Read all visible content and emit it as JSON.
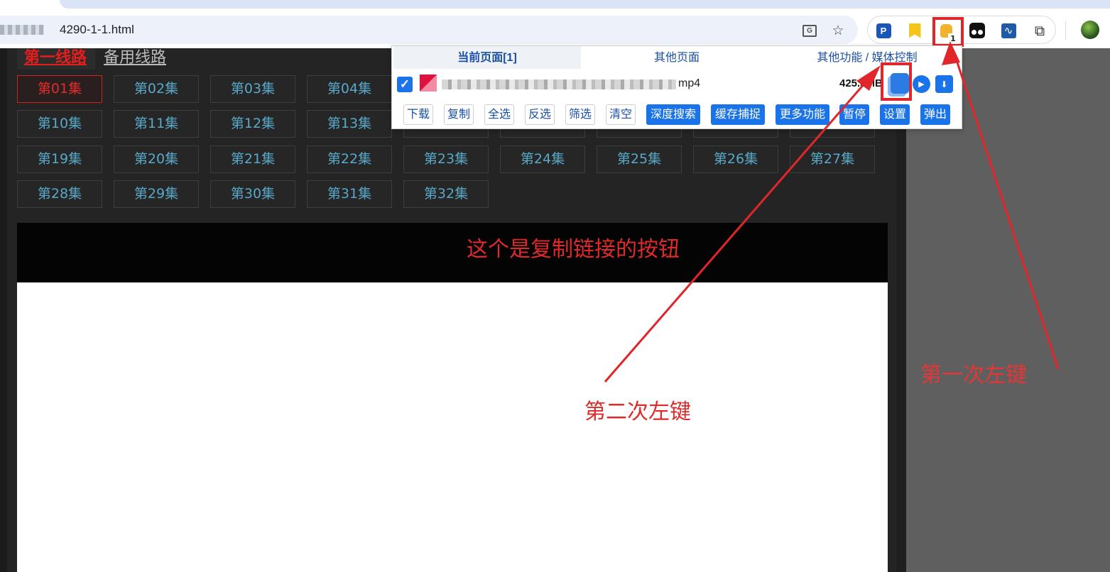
{
  "browser": {
    "url_visible": "4290-1-1.html",
    "extension_badge": "1"
  },
  "page": {
    "line_tabs": {
      "primary": "第一线路",
      "backup": "备用线路"
    },
    "episodes": [
      "第01集",
      "第02集",
      "第03集",
      "第04集",
      "第10集",
      "第11集",
      "第12集",
      "第13集",
      "第19集",
      "第20集",
      "第21集",
      "第22集",
      "第23集",
      "第24集",
      "第25集",
      "第26集",
      "第27集",
      "第28集",
      "第29集",
      "第30集",
      "第31集",
      "第32集"
    ],
    "active_episode": "第01集"
  },
  "popup": {
    "tabs": {
      "current": "当前页面[1]",
      "other": "其他页面",
      "more": "其他功能 / 媒体控制"
    },
    "media": {
      "ext": "mp4",
      "size": "425.3MB"
    },
    "actions": {
      "download": "下载",
      "copy": "复制",
      "select_all": "全选",
      "invert": "反选",
      "filter": "筛选",
      "clear": "清空",
      "deep_search": "深度搜索",
      "cache_capture": "缓存捕捉",
      "more_functions": "更多功能",
      "pause": "暂停",
      "settings": "设置",
      "popup": "弹出"
    }
  },
  "annotations": {
    "copy_button_note": "这个是复制链接的按钮",
    "second_click": "第二次左键",
    "first_click": "第一次左键"
  },
  "colors": {
    "annotation": "#e02a2a",
    "accent": "#1a73e8",
    "episode_text": "#58a8c8",
    "active_episode": "#e52b2b"
  }
}
